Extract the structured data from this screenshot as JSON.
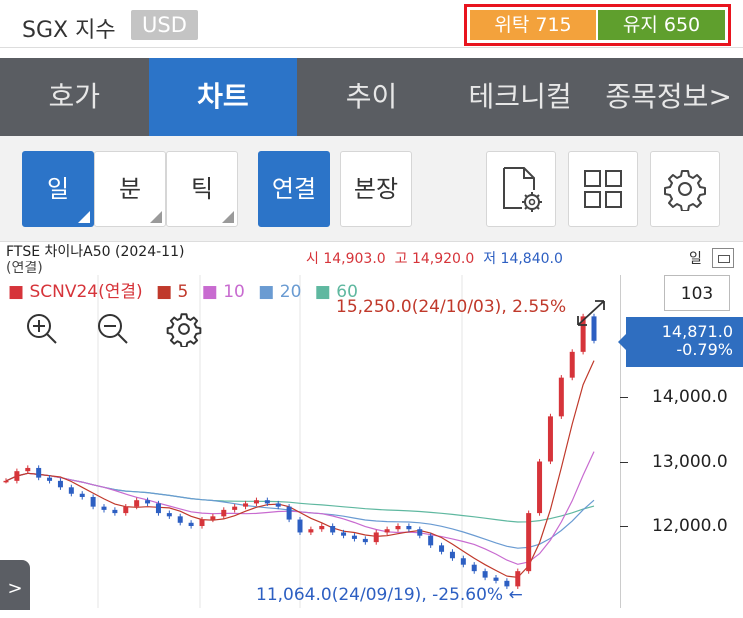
{
  "top": {
    "title": "SGX 지수",
    "currency": "USD",
    "margin_consign": "위탁 715",
    "margin_maintain": "유지 650"
  },
  "tabs": [
    {
      "label": "호가",
      "active": false
    },
    {
      "label": "차트",
      "active": true
    },
    {
      "label": "추이",
      "active": false
    },
    {
      "label": "테크니컬",
      "active": false
    },
    {
      "label": "종목정보>",
      "active": false
    }
  ],
  "toolbar": {
    "day": "일",
    "minute": "분",
    "tick": "틱",
    "linked": "연결",
    "main": "본장"
  },
  "info": {
    "instrument": "FTSE 차이나A50 (2024-11)",
    "instrument_sub": "(연결)",
    "open_label": "시",
    "open": "14,903.0",
    "high_label": "고",
    "high": "14,920.0",
    "low_label": "저",
    "low": "14,840.0",
    "period_label": "일"
  },
  "chart": {
    "legend_symbol": "SCNV24(연결)",
    "ma5": "5",
    "ma10": "10",
    "ma20": "20",
    "ma60": "60",
    "volume_count": "103",
    "last_price": "14,871.0",
    "last_change": "-0.79%",
    "high_annotation": "15,250.0(24/10/03), 2.55%",
    "low_annotation": "11,064.0(24/09/19), -25.60%",
    "sidebar_toggle": ">",
    "colors": {
      "up": "#d6343a",
      "down": "#2d5fc2",
      "ma5": "#c0392b",
      "ma10": "#c86bd0",
      "ma20": "#6a9bd2",
      "ma60": "#5fb8a0"
    }
  },
  "chart_data": {
    "type": "line",
    "y_ticks": [
      "14,000.0",
      "13,000.0",
      "12,000.0"
    ],
    "ylim": [
      11000,
      15300
    ],
    "series": [
      {
        "name": "SCNV24(연결)",
        "values": [
          12700,
          12850,
          12900,
          12750,
          12700,
          12600,
          12500,
          12450,
          12300,
          12250,
          12200,
          12300,
          12400,
          12350,
          12200,
          12150,
          12050,
          12000,
          12100,
          12150,
          12250,
          12300,
          12350,
          12400,
          12350,
          12300,
          12100,
          11900,
          11950,
          12000,
          11900,
          11850,
          11800,
          11750,
          11900,
          11950,
          12000,
          11950,
          11850,
          11700,
          11600,
          11500,
          11400,
          11300,
          11200,
          11150,
          11064,
          11300,
          12200,
          13000,
          13700,
          14300,
          14700,
          15250,
          14871
        ]
      }
    ]
  }
}
